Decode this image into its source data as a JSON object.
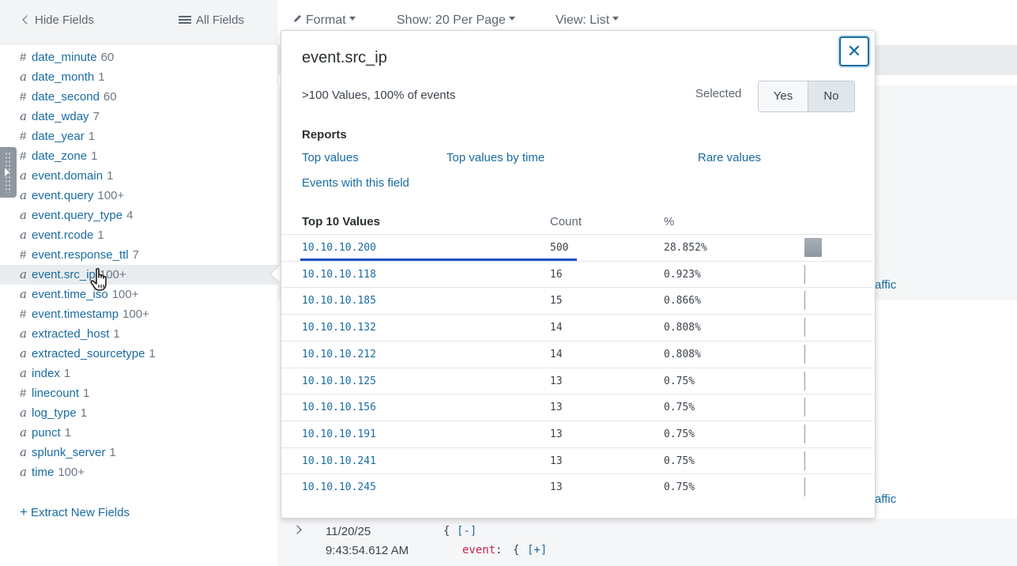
{
  "sidebar": {
    "hide_fields": "Hide Fields",
    "all_fields": "All Fields",
    "fields": [
      {
        "type": "#",
        "name": "date_minute",
        "count": "60"
      },
      {
        "type": "a",
        "name": "date_month",
        "count": "1"
      },
      {
        "type": "#",
        "name": "date_second",
        "count": "60"
      },
      {
        "type": "a",
        "name": "date_wday",
        "count": "7"
      },
      {
        "type": "#",
        "name": "date_year",
        "count": "1"
      },
      {
        "type": "#",
        "name": "date_zone",
        "count": "1"
      },
      {
        "type": "a",
        "name": "event.domain",
        "count": "1"
      },
      {
        "type": "a",
        "name": "event.query",
        "count": "100+"
      },
      {
        "type": "a",
        "name": "event.query_type",
        "count": "4"
      },
      {
        "type": "a",
        "name": "event.rcode",
        "count": "1"
      },
      {
        "type": "#",
        "name": "event.response_ttl",
        "count": "7"
      },
      {
        "type": "a",
        "name": "event.src_ip",
        "count": "100+"
      },
      {
        "type": "a",
        "name": "event.time_iso",
        "count": "100+"
      },
      {
        "type": "#",
        "name": "event.timestamp",
        "count": "100+"
      },
      {
        "type": "a",
        "name": "extracted_host",
        "count": "1"
      },
      {
        "type": "a",
        "name": "extracted_sourcetype",
        "count": "1"
      },
      {
        "type": "a",
        "name": "index",
        "count": "1"
      },
      {
        "type": "#",
        "name": "linecount",
        "count": "1"
      },
      {
        "type": "a",
        "name": "log_type",
        "count": "1"
      },
      {
        "type": "a",
        "name": "punct",
        "count": "1"
      },
      {
        "type": "a",
        "name": "splunk_server",
        "count": "1"
      },
      {
        "type": "a",
        "name": "time",
        "count": "100+"
      }
    ],
    "extract_plus": "+",
    "extract_label": "Extract New Fields"
  },
  "toolbar": {
    "format": "Format",
    "show": "Show: 20 Per Page",
    "view": "View: List"
  },
  "background": {
    "traffic_1": "affic",
    "traffic_2": "affic",
    "event_date": "11/20/25",
    "event_time": "9:43:54.612 AM",
    "brace_open": "{",
    "collapse": "[-]",
    "event_key": "event",
    "event_colon": ":",
    "expand": "[+]"
  },
  "popover": {
    "title": "event.src_ip",
    "close_glyph": "✕",
    "summary": ">100 Values, 100% of events",
    "selected_label": "Selected",
    "yes": "Yes",
    "no": "No",
    "reports_title": "Reports",
    "reports": {
      "top_values": "Top values",
      "top_values_by_time": "Top values by time",
      "rare_values": "Rare values",
      "events_with_field": "Events with this field"
    },
    "table_headers": {
      "value": "Top 10 Values",
      "count": "Count",
      "percent": "%"
    },
    "top_values": [
      {
        "value": "10.10.10.200",
        "count": "500",
        "percent": "28.852%"
      },
      {
        "value": "10.10.10.118",
        "count": "16",
        "percent": "0.923%"
      },
      {
        "value": "10.10.10.185",
        "count": "15",
        "percent": "0.866%"
      },
      {
        "value": "10.10.10.132",
        "count": "14",
        "percent": "0.808%"
      },
      {
        "value": "10.10.10.212",
        "count": "14",
        "percent": "0.808%"
      },
      {
        "value": "10.10.10.125",
        "count": "13",
        "percent": "0.75%"
      },
      {
        "value": "10.10.10.156",
        "count": "13",
        "percent": "0.75%"
      },
      {
        "value": "10.10.10.191",
        "count": "13",
        "percent": "0.75%"
      },
      {
        "value": "10.10.10.241",
        "count": "13",
        "percent": "0.75%"
      },
      {
        "value": "10.10.10.245",
        "count": "13",
        "percent": "0.75%"
      }
    ]
  },
  "colors": {
    "link": "#1a6ba0",
    "underline_accent": "#1e50c8",
    "event_key": "#c7254e"
  }
}
